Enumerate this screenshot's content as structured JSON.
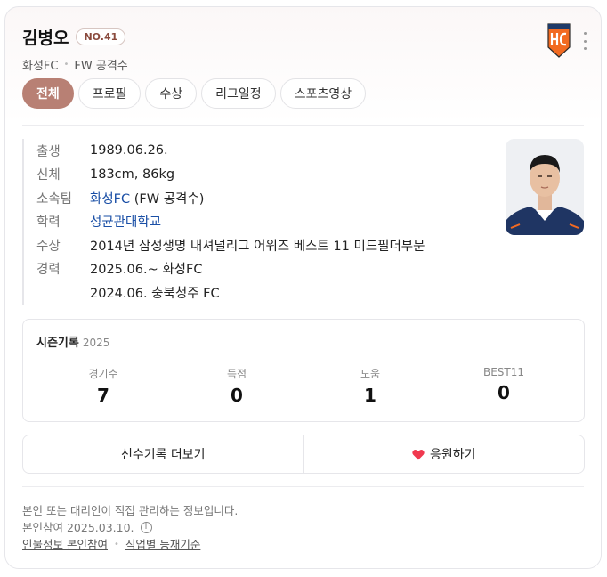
{
  "player": {
    "name": "김병오",
    "number": "NO.41",
    "team": "화성FC",
    "position": "FW 공격수"
  },
  "tabs": [
    {
      "label": "전체",
      "active": true
    },
    {
      "label": "프로필",
      "active": false
    },
    {
      "label": "수상",
      "active": false
    },
    {
      "label": "리그일정",
      "active": false
    },
    {
      "label": "스포츠영상",
      "active": false
    }
  ],
  "info": {
    "birth_label": "출생",
    "birth_value": "1989.06.26.",
    "body_label": "신체",
    "body_value": "183cm, 86kg",
    "team_label": "소속팀",
    "team_link": "화성FC",
    "team_extra": " (FW 공격수)",
    "school_label": "학력",
    "school_link": "성균관대학교",
    "award_label": "수상",
    "award_value": "2014년 삼성생명 내셔널리그 어워즈 베스트 11 미드필더부문",
    "career_label": "경력",
    "career_1": "2025.06.~ 화성FC",
    "career_2": "2024.06. 충북청주 FC"
  },
  "season": {
    "title": "시즌기록",
    "year": "2025",
    "stats": [
      {
        "label": "경기수",
        "value": "7"
      },
      {
        "label": "득점",
        "value": "0"
      },
      {
        "label": "도움",
        "value": "1"
      },
      {
        "label": "BEST11",
        "value": "0"
      }
    ]
  },
  "actions": {
    "more_records": "선수기록 더보기",
    "cheer": "응원하기"
  },
  "footer": {
    "notice": "본인 또는 대리인이 직접 관리하는 정보입니다.",
    "participation": "본인참여 2025.03.10.",
    "info_icon": "i",
    "link_1": "인물정보 본인참여",
    "link_2": "직업별 등재기준"
  },
  "colors": {
    "accent": "#b88074",
    "link": "#1a4fa6",
    "logo_orange": "#f26a21",
    "heart": "#f0394f"
  },
  "icons": [
    "team-logo-icon",
    "more-icon",
    "heart-icon",
    "info-icon"
  ]
}
